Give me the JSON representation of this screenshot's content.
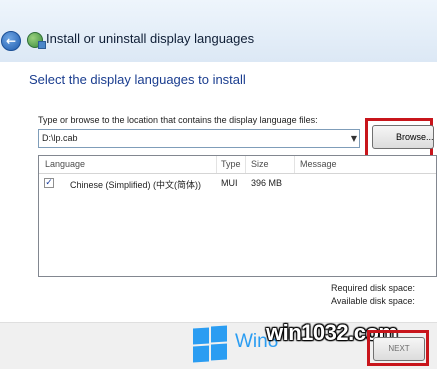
{
  "window": {
    "title": "Install or uninstall display languages",
    "back_icon": "back-arrow-icon",
    "app_icon": "language-globe-icon"
  },
  "main": {
    "heading": "Select the display languages to install",
    "location_label": "Type or browse to the location that contains the display language files:",
    "path_value": "D:\\lp.cab",
    "browse_label": "Browse..."
  },
  "list": {
    "columns": [
      "Language",
      "Type",
      "Size",
      "Message"
    ],
    "rows": [
      {
        "checked": true,
        "language": "Chinese (Simplified) (中文(简体))",
        "type": "MUI",
        "size": "396 MB",
        "message": ""
      }
    ]
  },
  "disk": {
    "required_label": "Required disk space:",
    "available_label": "Available disk space:"
  },
  "footer": {
    "next_label": "NEXT",
    "brand_text": "Win8",
    "watermark": "win1032.com"
  },
  "colors": {
    "heading": "#1a3d8f",
    "highlight": "#c8151b",
    "brand": "#2b9df2"
  }
}
